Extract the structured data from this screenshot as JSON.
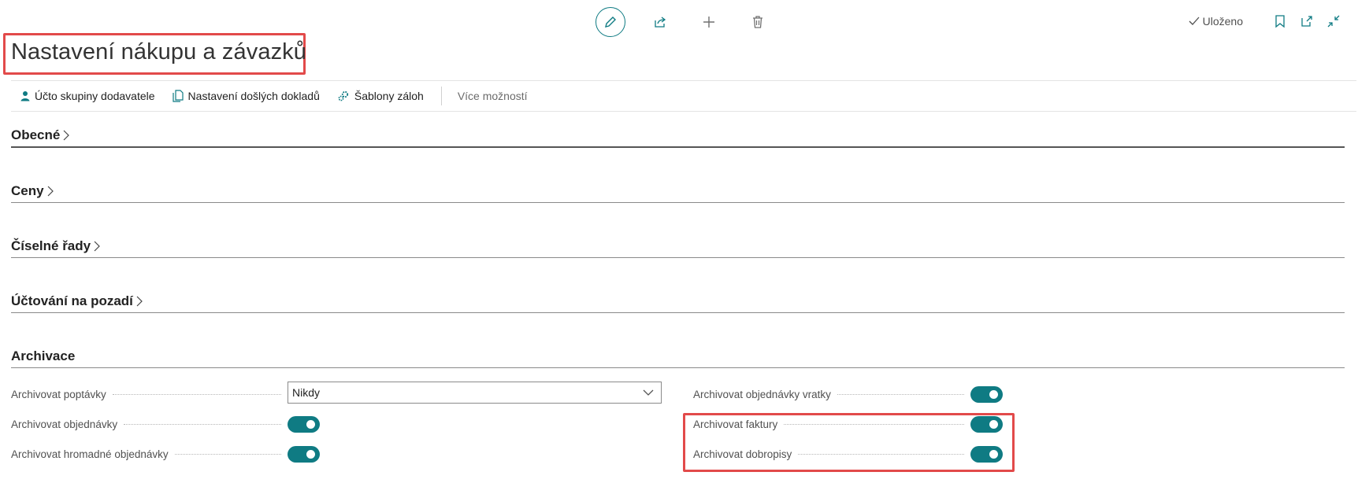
{
  "toolbar": {
    "edit_icon": "pencil-icon",
    "share_icon": "share-icon",
    "new_icon": "plus-icon",
    "delete_icon": "trash-icon",
    "saved_label": "Uloženo",
    "bookmark_icon": "bookmark-icon",
    "open_new_window_icon": "open-new-window-icon",
    "collapse_icon": "collapse-icon"
  },
  "page": {
    "title": "Nastavení nákupu a závazků"
  },
  "actions": {
    "vendor_posting_groups": "Účto skupiny dodavatele",
    "incoming_documents_setup": "Nastavení došlých dokladů",
    "advance_templates": "Šablony záloh",
    "more_options": "Více možností"
  },
  "sections": {
    "general": "Obecné",
    "prices": "Ceny",
    "number_series": "Číselné řady",
    "background_posting": "Účtování na pozadí",
    "archiving": "Archivace"
  },
  "fields": {
    "archive_quotes": {
      "label": "Archivovat poptávky",
      "value": "Nikdy"
    },
    "archive_orders": {
      "label": "Archivovat objednávky",
      "on": true
    },
    "archive_blanket_orders": {
      "label": "Archivovat hromadné objednávky",
      "on": true
    },
    "archive_return_orders": {
      "label": "Archivovat objednávky vratky",
      "on": true
    },
    "archive_invoices": {
      "label": "Archivovat faktury",
      "on": true
    },
    "archive_credit_memos": {
      "label": "Archivovat dobropisy",
      "on": true
    }
  },
  "colors": {
    "accent": "#0f7b83",
    "highlight": "#e24a4a"
  }
}
